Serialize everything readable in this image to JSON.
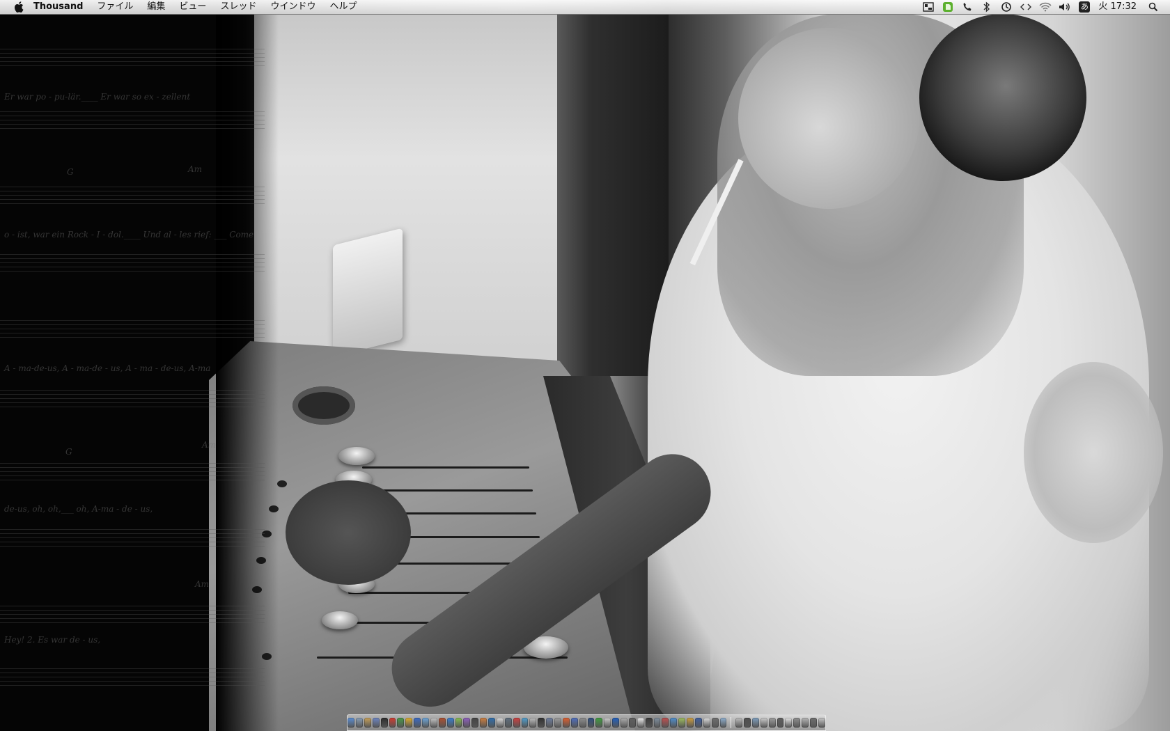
{
  "menubar": {
    "app_name": "Thousand",
    "menus": [
      "ファイル",
      "編集",
      "ビュー",
      "スレッド",
      "ウインドウ",
      "ヘルプ"
    ],
    "clock": "火 17:32",
    "input_method": "あ",
    "status_icons": [
      "screen-icon",
      "evernote-icon",
      "phone-icon",
      "bluetooth-icon",
      "time-machine-icon",
      "code-icon",
      "wifi-icon",
      "volume-icon",
      "input-method-icon",
      "spotlight-icon"
    ]
  },
  "wallpaper": {
    "sheet_music_lyrics": [
      "Er  war  po - pu-lär.____   Er  war  so    ex  -  zellent",
      "o - ist,  war  ein  Rock - I - dol.____    Und    al - les rief: ___ Come",
      "A - ma-de-us,                A   -   ma-de - us,  A - ma - de-us, A-ma",
      "de-us,                oh,    oh,___    oh,  A-ma - de - us,",
      "Hey!                          2.  Es  war    de - us,"
    ],
    "chords": [
      "G",
      "Am",
      "G",
      "Am",
      "Am"
    ]
  },
  "colors": {
    "menubar_bg": "#e6e6e6",
    "wallpaper_dark": "#050505",
    "wallpaper_light": "#e3e3e3"
  },
  "dock": {
    "icons": [
      "#5b8fd6",
      "#8aa0b8",
      "#c9a25a",
      "#6d86c4",
      "#2c2c2c",
      "#d43a2f",
      "#4a9a4a",
      "#e0b030",
      "#3a6cc8",
      "#6fa8dc",
      "#c8c8c8",
      "#b05030",
      "#3b7fd0",
      "#88c050",
      "#9060c0",
      "#444",
      "#d08040",
      "#3070b0",
      "#e0e0e0",
      "#607080",
      "#d04040",
      "#50a0d0",
      "#c0c0c0",
      "#303030",
      "#7080a0",
      "#a0a0a0",
      "#e06030",
      "#5070c0",
      "#909090",
      "#305080",
      "#40a040",
      "#d0d0d0",
      "#2060c0",
      "#b0b0b0",
      "#606060",
      "#f0f0f0",
      "#3a3a3a",
      "#8090a0",
      "#c05050",
      "#5090d0",
      "#a0c060",
      "#d0a040",
      "#4060a0",
      "#e0e0e0",
      "#707070",
      "#90b0d0",
      "#c0c0c0",
      "#505050",
      "#80a0c0",
      "#d0d0d0",
      "#a0a0a0",
      "#606060",
      "#e8e8e8",
      "#909090",
      "#b8b8b8",
      "#707070",
      "#c8c8c8"
    ]
  }
}
